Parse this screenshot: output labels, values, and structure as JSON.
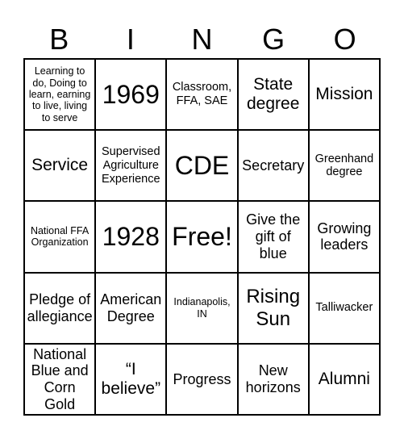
{
  "header": {
    "letters": [
      "B",
      "I",
      "N",
      "G",
      "O"
    ]
  },
  "board": {
    "rows": [
      [
        {
          "text": "Learning to do, Doing to learn, earning to live, living to serve",
          "size": "xs"
        },
        {
          "text": "1969",
          "size": "xxl"
        },
        {
          "text": "Classroom, FFA, SAE",
          "size": "s"
        },
        {
          "text": "State degree",
          "size": "l"
        },
        {
          "text": "Mission",
          "size": "l"
        }
      ],
      [
        {
          "text": "Service",
          "size": "l"
        },
        {
          "text": "Supervised Agriculture Experience",
          "size": "s"
        },
        {
          "text": "CDE",
          "size": "xxl"
        },
        {
          "text": "Secretary",
          "size": "m"
        },
        {
          "text": "Greenhand degree",
          "size": "s"
        }
      ],
      [
        {
          "text": "National FFA Organization",
          "size": "xs"
        },
        {
          "text": "1928",
          "size": "xxl"
        },
        {
          "text": "Free!",
          "size": "xxl"
        },
        {
          "text": "Give the gift of blue",
          "size": "m"
        },
        {
          "text": "Growing leaders",
          "size": "m"
        }
      ],
      [
        {
          "text": "Pledge of allegiance",
          "size": "m"
        },
        {
          "text": "American Degree",
          "size": "m"
        },
        {
          "text": "Indianapolis, IN",
          "size": "xs"
        },
        {
          "text": "Rising Sun",
          "size": "xl"
        },
        {
          "text": "Talliwacker",
          "size": "s"
        }
      ],
      [
        {
          "text": "National Blue and Corn Gold",
          "size": "m"
        },
        {
          "text": "“I believe”",
          "size": "l"
        },
        {
          "text": "Progress",
          "size": "m"
        },
        {
          "text": "New horizons",
          "size": "m"
        },
        {
          "text": "Alumni",
          "size": "l"
        }
      ]
    ]
  }
}
